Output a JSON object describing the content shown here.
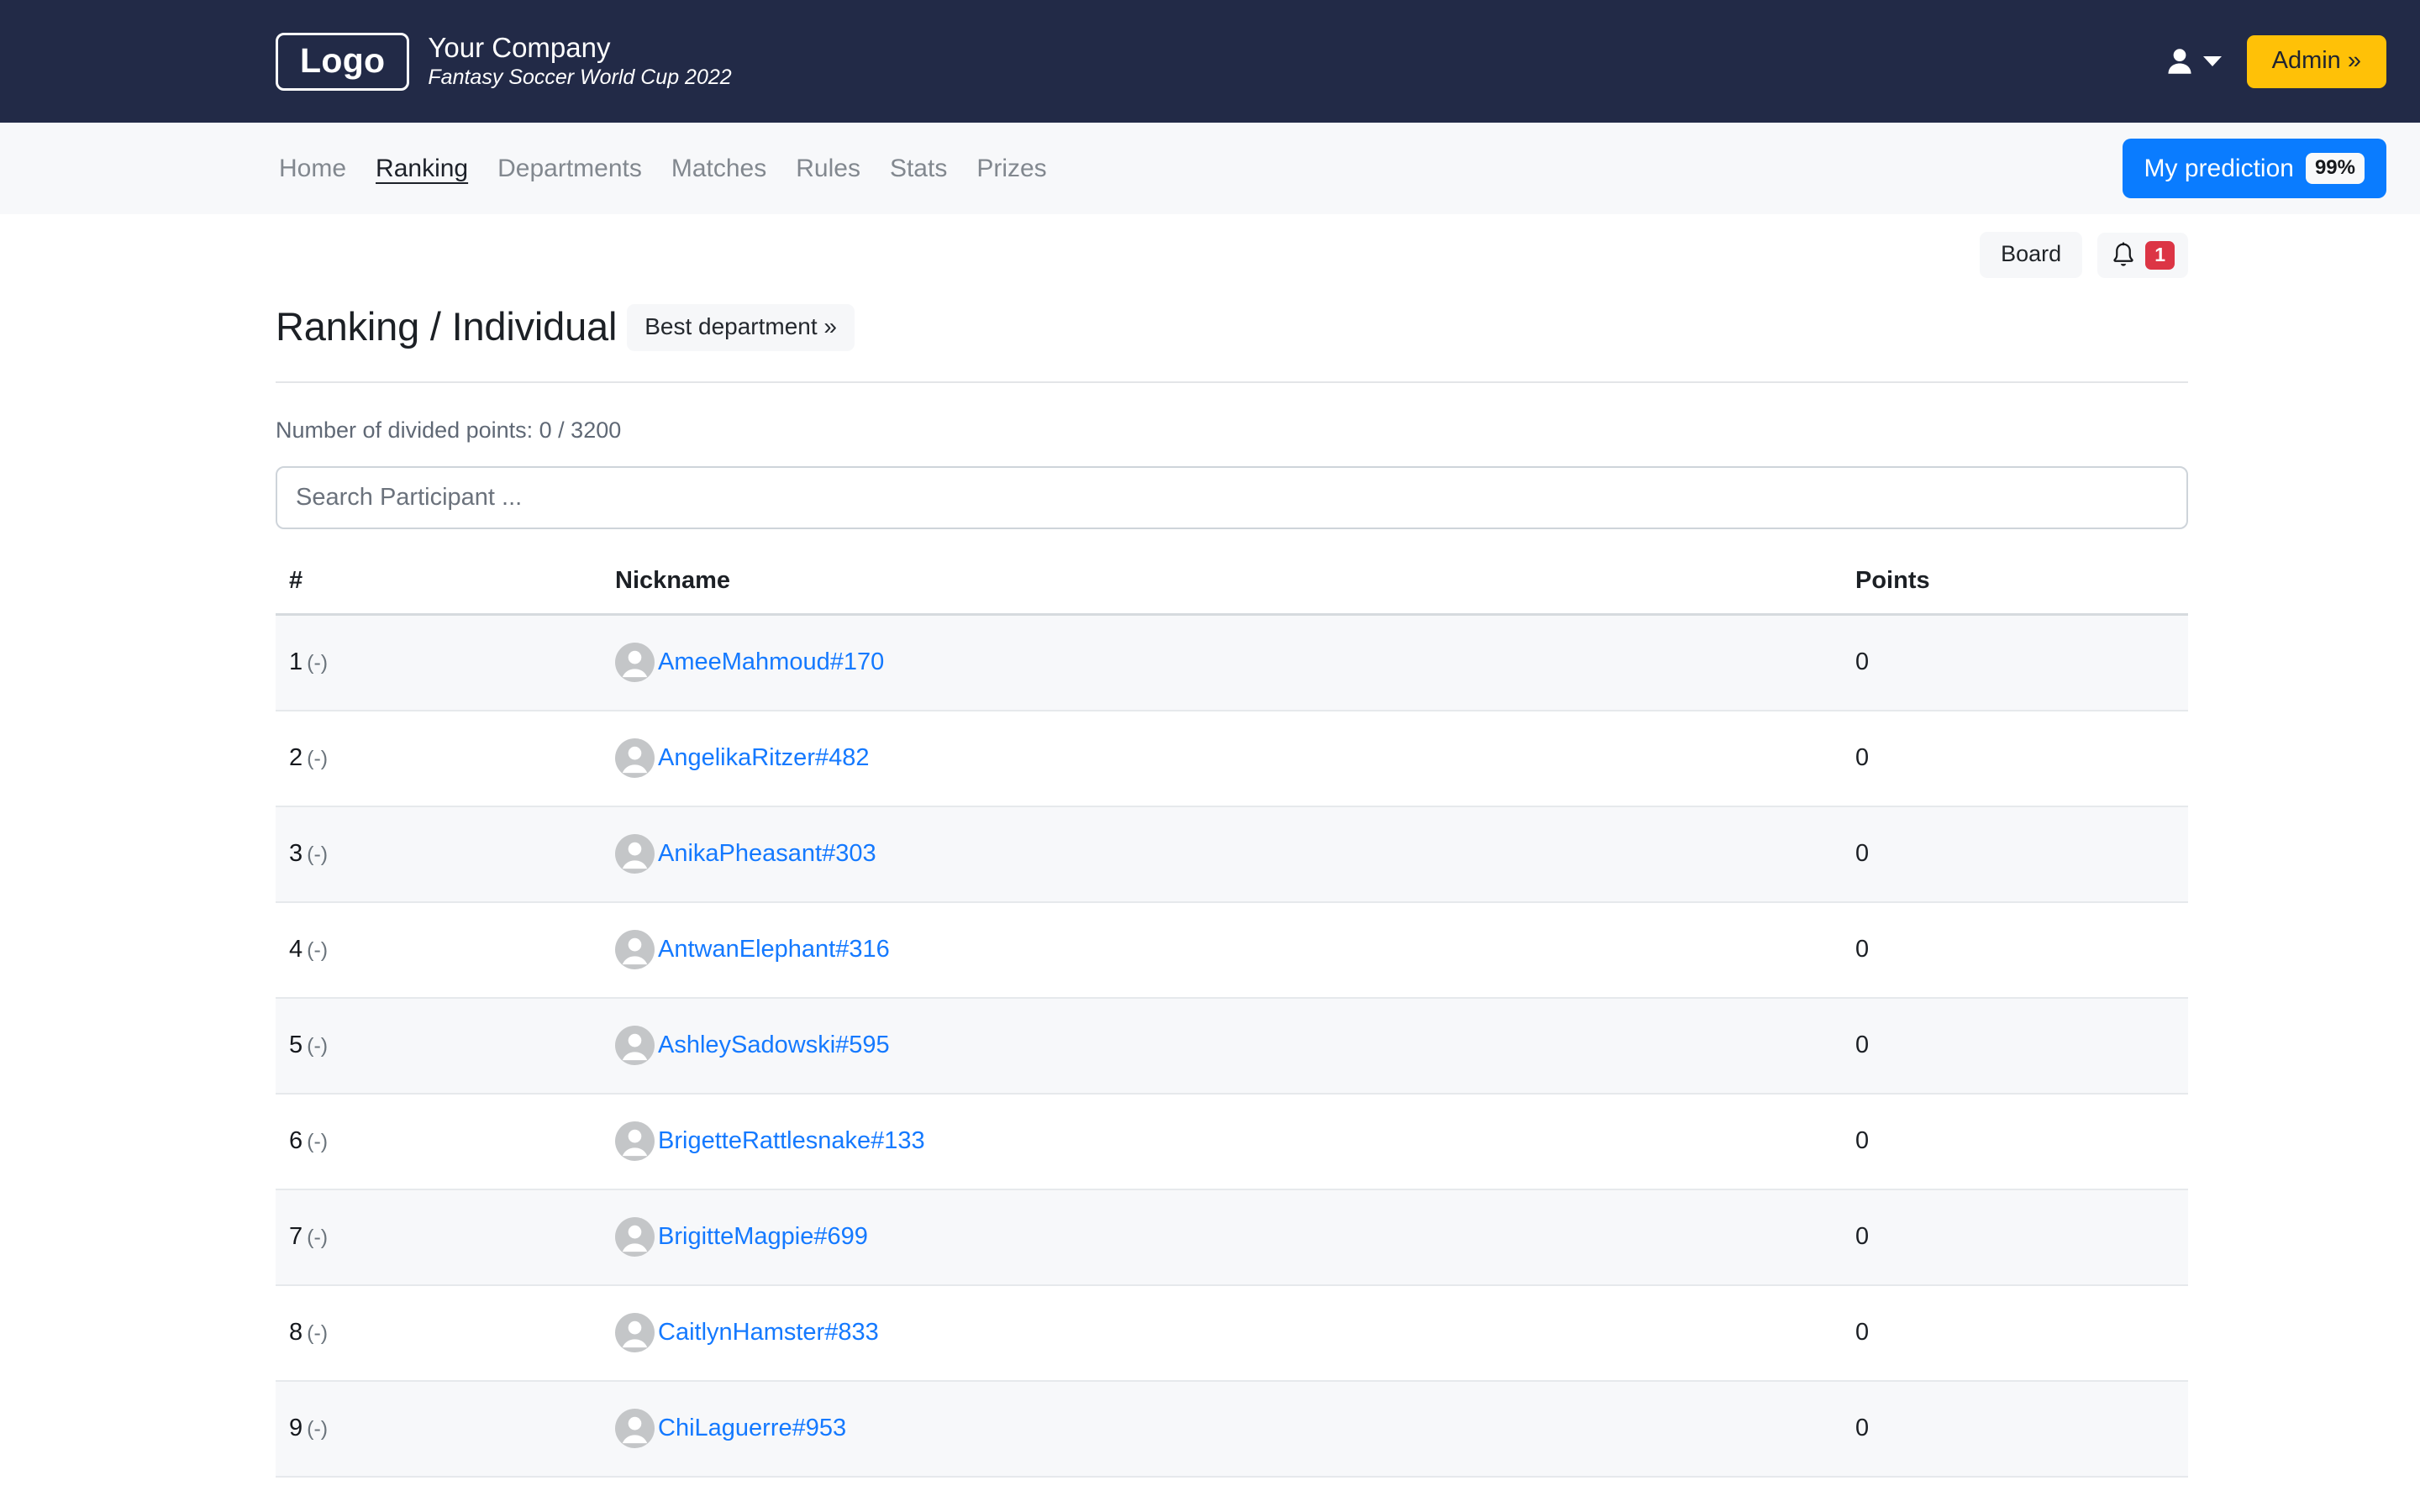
{
  "header": {
    "logo_text": "Logo",
    "company_name": "Your Company",
    "tagline": "Fantasy Soccer World Cup 2022",
    "admin_label": "Admin »",
    "user_icon": "user-icon",
    "caret_icon": "chevron-down-icon",
    "accent_admin_color": "#ffc107",
    "background_color": "#222a47"
  },
  "nav": {
    "items": [
      {
        "label": "Home",
        "active": false
      },
      {
        "label": "Ranking",
        "active": true
      },
      {
        "label": "Departments",
        "active": false
      },
      {
        "label": "Matches",
        "active": false
      },
      {
        "label": "Rules",
        "active": false
      },
      {
        "label": "Stats",
        "active": false
      },
      {
        "label": "Prizes",
        "active": false
      }
    ],
    "prediction_label": "My prediction",
    "prediction_badge": "99%",
    "prediction_color": "#0a7cff"
  },
  "subbar": {
    "board_label": "Board",
    "bell_icon": "bell-icon",
    "bell_badge": "1",
    "bell_badge_color": "#dc3545"
  },
  "main": {
    "title": "Ranking / Individual",
    "best_department_label": "Best department »",
    "divided_points": "Number of divided points: 0 / 3200",
    "search_placeholder": "Search Participant ...",
    "search_value": ""
  },
  "table": {
    "headers": {
      "rank": "#",
      "nickname": "Nickname",
      "points": "Points"
    },
    "rows": [
      {
        "rank": "1",
        "delta": "(-)",
        "nickname": "AmeeMahmoud#170",
        "points": "0"
      },
      {
        "rank": "2",
        "delta": "(-)",
        "nickname": "AngelikaRitzer#482",
        "points": "0"
      },
      {
        "rank": "3",
        "delta": "(-)",
        "nickname": "AnikaPheasant#303",
        "points": "0"
      },
      {
        "rank": "4",
        "delta": "(-)",
        "nickname": "AntwanElephant#316",
        "points": "0"
      },
      {
        "rank": "5",
        "delta": "(-)",
        "nickname": "AshleySadowski#595",
        "points": "0"
      },
      {
        "rank": "6",
        "delta": "(-)",
        "nickname": "BrigetteRattlesnake#133",
        "points": "0"
      },
      {
        "rank": "7",
        "delta": "(-)",
        "nickname": "BrigitteMagpie#699",
        "points": "0"
      },
      {
        "rank": "8",
        "delta": "(-)",
        "nickname": "CaitlynHamster#833",
        "points": "0"
      },
      {
        "rank": "9",
        "delta": "(-)",
        "nickname": "ChiLaguerre#953",
        "points": "0"
      }
    ]
  }
}
